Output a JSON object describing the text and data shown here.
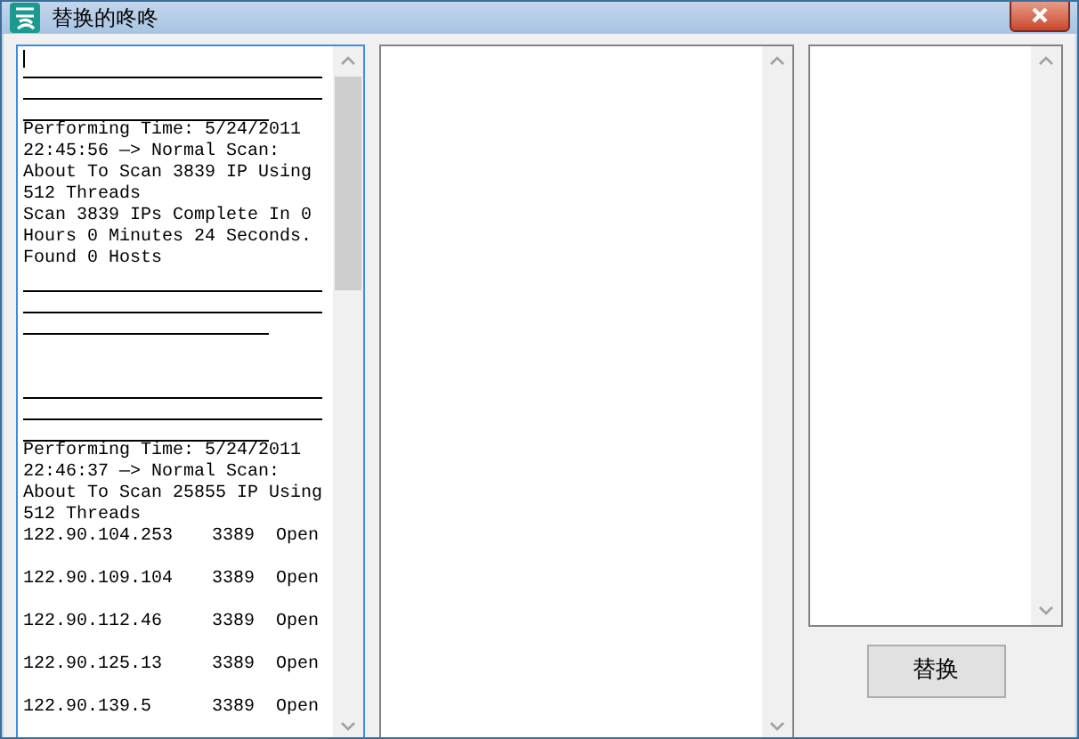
{
  "window": {
    "title": "替换的咚咚"
  },
  "log": [
    {
      "kind": "rule"
    },
    {
      "kind": "rule"
    },
    {
      "kind": "short_rule"
    },
    {
      "kind": "text",
      "text": "Performing Time: 5/24/2011"
    },
    {
      "kind": "text",
      "text": "22:45:56 —> Normal Scan:"
    },
    {
      "kind": "text",
      "text": "About To Scan 3839 IP Using"
    },
    {
      "kind": "text",
      "text": "512 Threads"
    },
    {
      "kind": "text",
      "text": "Scan 3839 IPs Complete In 0"
    },
    {
      "kind": "text",
      "text": "Hours 0 Minutes 24 Seconds."
    },
    {
      "kind": "text",
      "text": "Found 0 Hosts"
    },
    {
      "kind": "rule"
    },
    {
      "kind": "rule"
    },
    {
      "kind": "short_rule"
    },
    {
      "kind": "gap"
    },
    {
      "kind": "rule"
    },
    {
      "kind": "rule"
    },
    {
      "kind": "short_rule"
    },
    {
      "kind": "text",
      "text": "Performing Time: 5/24/2011"
    },
    {
      "kind": "text",
      "text": "22:46:37 —> Normal Scan:"
    },
    {
      "kind": "text",
      "text": "About To Scan 25855 IP Using"
    },
    {
      "kind": "text",
      "text": "512 Threads"
    },
    {
      "kind": "row",
      "cells": [
        "122.90.104.253",
        "3389",
        "Open"
      ]
    },
    {
      "kind": "row",
      "cells": [
        "122.90.109.104",
        "3389",
        "Open"
      ]
    },
    {
      "kind": "row",
      "cells": [
        "122.90.112.46",
        "3389",
        "Open"
      ]
    },
    {
      "kind": "row",
      "cells": [
        "122.90.125.13",
        "3389",
        "Open"
      ]
    },
    {
      "kind": "row",
      "cells": [
        "122.90.139.5",
        "3389",
        "Open"
      ]
    }
  ],
  "replace_button": {
    "label": "替换"
  }
}
